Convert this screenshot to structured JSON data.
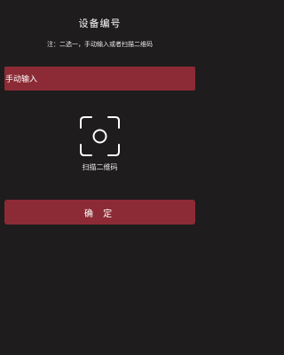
{
  "page": {
    "title": "设备编号",
    "note": "注：二选一，手动输入或者扫描二维码"
  },
  "manual_input": {
    "value": "手动输入"
  },
  "scan": {
    "icon": "scan-qr-icon",
    "label": "扫描二维码"
  },
  "actions": {
    "confirm_label": "确 定"
  },
  "colors": {
    "background": "#1e1c1d",
    "accent": "#8c2b35",
    "text": "#ffffff"
  }
}
